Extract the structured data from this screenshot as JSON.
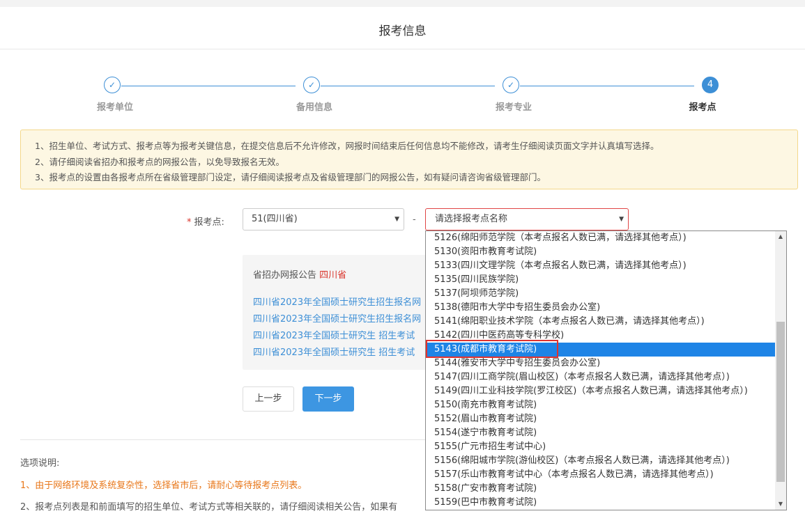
{
  "header": {
    "title": "报考信息"
  },
  "steps": [
    {
      "label": "报考单位",
      "icon": "check-icon",
      "state": "done"
    },
    {
      "label": "备用信息",
      "icon": "check-icon",
      "state": "done"
    },
    {
      "label": "报考专业",
      "icon": "check-icon",
      "state": "done"
    },
    {
      "label": "报考点",
      "number": "4",
      "state": "active"
    }
  ],
  "notice": {
    "lines": [
      "1、招生单位、考试方式、报考点等为报考关键信息，在提交信息后不允许修改，网报时间结束后任何信息均不能修改，请考生仔细阅读页面文字并认真填写选择。",
      "2、请仔细阅读省招办和报考点的网报公告，以免导致报名无效。",
      "3、报考点的设置由各报考点所在省级管理部门设定，请仔细阅读报考点及省级管理部门的网报公告，如有疑问请咨询省级管理部门。"
    ]
  },
  "form": {
    "required_mark": "*",
    "label": "报考点:",
    "province_value": "51(四川省)",
    "dash": "-",
    "point_placeholder": "请选择报考点名称"
  },
  "announce": {
    "title_prefix": "省招办网报公告",
    "title_province": "四川省",
    "links": [
      "四川省2023年全国硕士研究生招生报名网",
      "四川省2023年全国硕士研究生招生报名网",
      "四川省2023年全国硕士研究生 招生考试",
      "四川省2023年全国硕士研究生 招生考试"
    ]
  },
  "buttons": {
    "prev": "上一步",
    "next": "下一步"
  },
  "options": {
    "title": "选项说明:",
    "item1": "1、由于网络环境及系统复杂性，选择省市后，请耐心等待报考点列表。",
    "item2": "2、报考点列表是和前面填写的招生单位、考试方式等相关联的，请仔细阅读相关公告，如果有"
  },
  "dropdown": {
    "selected_index": 8,
    "items": [
      "5126(绵阳师范学院（本考点报名人数已满，请选择其他考点）)",
      "5130(资阳市教育考试院)",
      "5133(四川文理学院（本考点报名人数已满，请选择其他考点）)",
      "5135(四川民族学院)",
      "5137(阿坝师范学院)",
      "5138(德阳市大学中专招生委员会办公室)",
      "5141(绵阳职业技术学院（本考点报名人数已满，请选择其他考点）)",
      "5142(四川中医药高等专科学校)",
      "5143(成都市教育考试院)",
      "5144(雅安市大学中专招生委员会办公室)",
      "5147(四川工商学院(眉山校区)（本考点报名人数已满，请选择其他考点）)",
      "5149(四川工业科技学院(罗江校区)（本考点报名人数已满，请选择其他考点）)",
      "5150(南充市教育考试院)",
      "5152(眉山市教育考试院)",
      "5154(遂宁市教育考试院)",
      "5155(广元市招生考试中心)",
      "5156(绵阳城市学院(游仙校区)（本考点报名人数已满，请选择其他考点）)",
      "5157(乐山市教育考试中心（本考点报名人数已满，请选择其他考点）)",
      "5158(广安市教育考试院)",
      "5159(巴中市教育考试院)"
    ]
  }
}
